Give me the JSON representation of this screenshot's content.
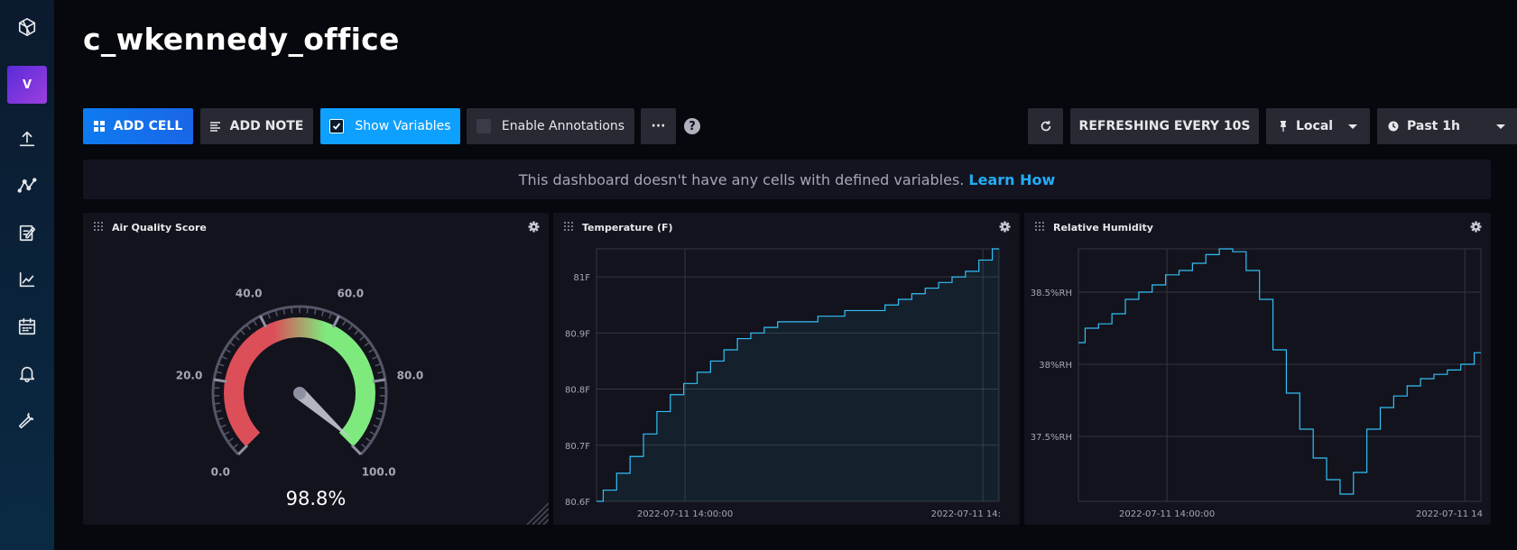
{
  "dashboard": {
    "title": "c_wkennedy_office"
  },
  "sidebar": {
    "avatar_letter": "V",
    "icons": [
      "influx-logo-icon",
      "upload-icon",
      "graph-nodes-icon",
      "notebook-edit-icon",
      "line-chart-icon",
      "calendar-icon",
      "bell-icon",
      "wrench-icon"
    ]
  },
  "toolbar": {
    "add_cell": "ADD CELL",
    "add_note": "ADD NOTE",
    "show_variables": "Show Variables",
    "show_variables_checked": true,
    "enable_annotations": "Enable Annotations",
    "enable_annotations_checked": false,
    "more": "···",
    "help": "?",
    "refreshing": "REFRESHING EVERY 10S",
    "timezone": "Local",
    "time_range": "Past 1h"
  },
  "banner": {
    "text": "This dashboard doesn't have any cells with defined variables.",
    "link": "Learn How"
  },
  "colors": {
    "accent": "#0ea0ff",
    "line": "#31c0f6",
    "gauge_low": "#dc4e58",
    "gauge_high": "#7eea7e"
  },
  "cells": {
    "air": {
      "title": "Air Quality Score",
      "value_label": "98.8%"
    },
    "temp": {
      "title": "Temperature (F)"
    },
    "hum": {
      "title": "Relative Humidity"
    }
  },
  "chart_data": [
    {
      "type": "gauge",
      "title": "Air Quality Score",
      "value": 98.8,
      "min": 0,
      "max": 100,
      "tick_labels": [
        "0.0",
        "20.0",
        "40.0",
        "60.0",
        "80.0",
        "100.0"
      ],
      "tick_values": [
        0,
        20,
        40,
        60,
        80,
        100
      ]
    },
    {
      "type": "area",
      "title": "Temperature (F)",
      "ylim": [
        80.6,
        81.05
      ],
      "y_ticks": [
        80.6,
        80.7,
        80.8,
        80.9,
        81.0
      ],
      "y_tick_labels": [
        "80.6F",
        "80.7F",
        "80.8F",
        "80.9F",
        "81F"
      ],
      "x_tick_labels": [
        "2022-07-11 14:00:00",
        "2022-07-11 14:"
      ],
      "x": [
        0,
        2,
        4,
        6,
        8,
        10,
        12,
        14,
        16,
        18,
        20,
        22,
        24,
        26,
        28,
        30,
        32,
        34,
        36,
        38,
        40,
        42,
        44,
        46,
        48,
        50,
        52,
        54,
        56,
        58,
        60
      ],
      "values": [
        80.6,
        80.62,
        80.65,
        80.68,
        80.72,
        80.76,
        80.79,
        80.81,
        80.83,
        80.85,
        80.87,
        80.89,
        80.9,
        80.91,
        80.92,
        80.92,
        80.92,
        80.93,
        80.93,
        80.94,
        80.94,
        80.94,
        80.95,
        80.96,
        80.97,
        80.98,
        80.99,
        81.0,
        81.01,
        81.03,
        81.05
      ]
    },
    {
      "type": "line",
      "title": "Relative Humidity",
      "ylim": [
        37.05,
        38.8
      ],
      "y_ticks": [
        37.5,
        38.0,
        38.5
      ],
      "y_tick_labels": [
        "37.5%RH",
        "38%RH",
        "38.5%RH"
      ],
      "x_tick_labels": [
        "2022-07-11 14:00:00",
        "2022-07-11 14"
      ],
      "x": [
        0,
        2,
        4,
        6,
        8,
        10,
        12,
        14,
        16,
        18,
        20,
        22,
        24,
        26,
        28,
        30,
        32,
        34,
        36,
        38,
        40,
        42,
        44,
        46,
        48,
        50,
        52,
        54,
        56,
        58,
        60
      ],
      "values": [
        38.15,
        38.25,
        38.28,
        38.35,
        38.45,
        38.5,
        38.55,
        38.62,
        38.65,
        38.7,
        38.76,
        38.8,
        38.78,
        38.65,
        38.45,
        38.1,
        37.8,
        37.55,
        37.35,
        37.2,
        37.1,
        37.25,
        37.55,
        37.7,
        37.78,
        37.85,
        37.9,
        37.93,
        37.96,
        38.0,
        38.08
      ]
    }
  ]
}
